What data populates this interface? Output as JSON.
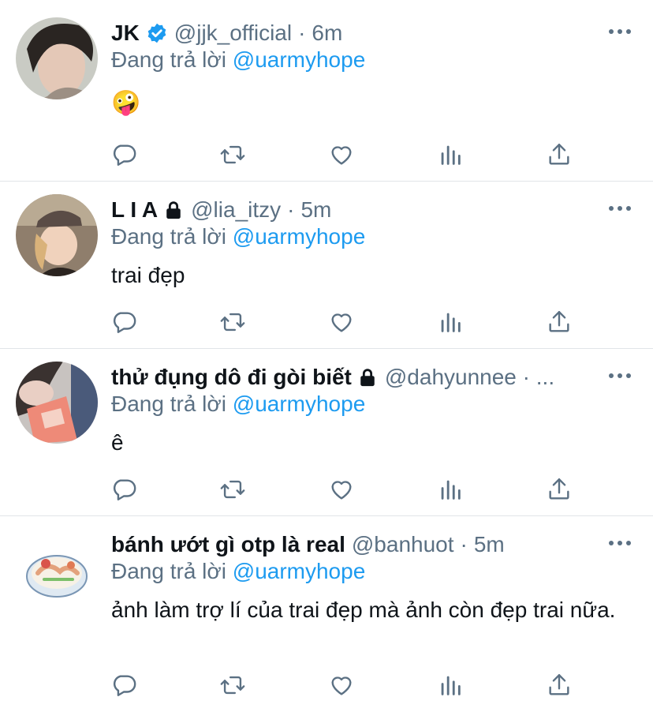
{
  "reply_prefix": "Đang trả lời",
  "colors": {
    "link": "#1d9bf0",
    "muted": "#5b7083",
    "text": "#0f1419",
    "divider": "#e1e4e8"
  },
  "tweets": [
    {
      "name": "JK",
      "verified": true,
      "handle": "@jjk_official",
      "time": "6m",
      "reply_to": "@uarmyhope",
      "text": "🤪",
      "avatar_icon": "user-avatar-photo"
    },
    {
      "name": "L I A",
      "locked": true,
      "handle": "@lia_itzy",
      "time": "5m",
      "reply_to": "@uarmyhope",
      "text": "trai đẹp",
      "avatar_icon": "user-avatar-photo"
    },
    {
      "name": "thử đụng dô đi gòi biết",
      "locked": true,
      "handle": "@dahyunnee · ...",
      "time": "",
      "reply_to": "@uarmyhope",
      "text": "ê",
      "avatar_icon": "user-avatar-photo"
    },
    {
      "name": "bánh ướt gì otp là real",
      "handle": "@banhuot",
      "time": "5m",
      "reply_to": "@uarmyhope",
      "text": "ảnh làm trợ lí của trai đẹp mà ảnh còn đẹp trai nữa.",
      "avatar_icon": "food-avatar-illustration"
    }
  ],
  "action_icons": [
    "reply-icon",
    "retweet-icon",
    "like-icon",
    "analytics-icon",
    "share-icon"
  ]
}
